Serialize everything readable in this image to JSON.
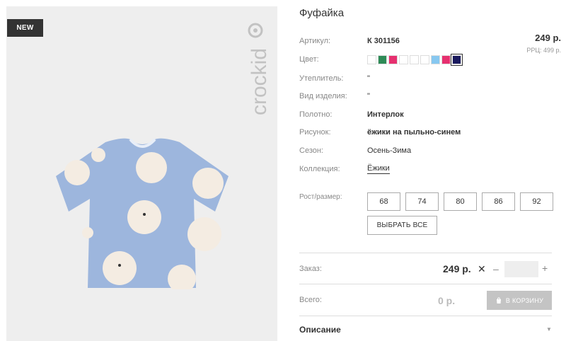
{
  "badge": {
    "text": "NEW"
  },
  "brand": {
    "logo_text": "crockid"
  },
  "product": {
    "title": "Фуфайка",
    "price": "249 р.",
    "rrp": "РРЦ: 499 р."
  },
  "attributes": [
    {
      "label": "Артикул:",
      "value": "К 301156"
    },
    {
      "label": "Цвет:",
      "value": ""
    },
    {
      "label": "Утеплитель:",
      "value": "\""
    },
    {
      "label": "Вид изделия:",
      "value": "\""
    },
    {
      "label": "Полотно:",
      "value": "Интерлок"
    },
    {
      "label": "Рисунок:",
      "value": "ёжики на пыльно-синем"
    },
    {
      "label": "Сезон:",
      "value": "Осень-Зима"
    },
    {
      "label": "Коллекция:",
      "value": "Ёжики"
    }
  ],
  "colors": [
    {
      "hex": "#ffffff",
      "selected": false
    },
    {
      "hex": "#2e8b57",
      "selected": false
    },
    {
      "hex": "#e6306f",
      "selected": false
    },
    {
      "hex": "#ffffff",
      "selected": false
    },
    {
      "hex": "#ffffff",
      "selected": false
    },
    {
      "hex": "#ffffff",
      "selected": false
    },
    {
      "hex": "#87c8f0",
      "selected": false
    },
    {
      "hex": "#e6306f",
      "selected": false
    },
    {
      "hex": "#1a1a5e",
      "selected": true
    }
  ],
  "sizes": {
    "label": "Рост/размер:",
    "options": [
      "68",
      "74",
      "80",
      "86",
      "92"
    ],
    "select_all": "ВЫБРАТЬ ВСЕ"
  },
  "order": {
    "label": "Заказ:",
    "price": "249 р.",
    "quantity": ""
  },
  "total": {
    "label": "Всего:",
    "value": "0 р.",
    "cart_button": "В КОРЗИНУ"
  },
  "description": {
    "label": "Описание"
  }
}
